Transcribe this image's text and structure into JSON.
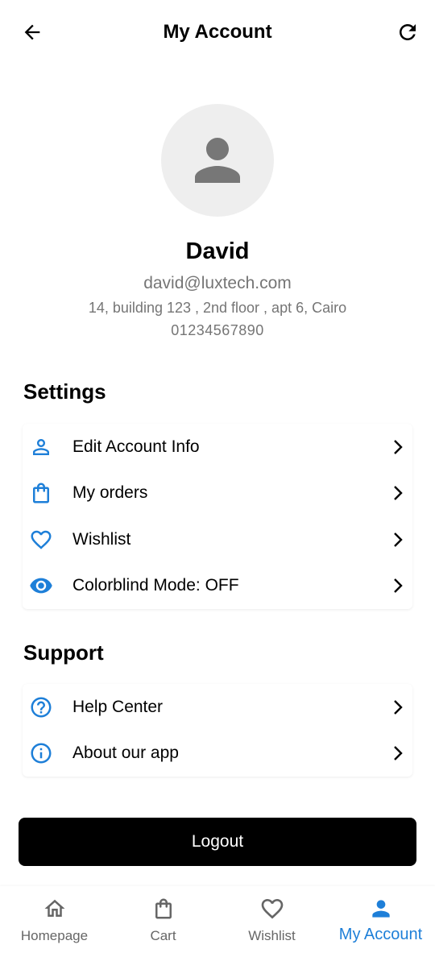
{
  "appbar": {
    "title": "My Account",
    "back_icon": "arrow-back-icon",
    "refresh_icon": "refresh-icon"
  },
  "profile": {
    "name": "David",
    "email": "david@luxtech.com",
    "address": "14, building 123 , 2nd floor , apt 6, Cairo",
    "phone": "01234567890",
    "avatar_icon": "person-icon"
  },
  "settings": {
    "title": "Settings",
    "items": [
      {
        "label": "Edit Account Info",
        "icon": "person-outline-icon"
      },
      {
        "label": "My orders",
        "icon": "shopping-bag-icon"
      },
      {
        "label": "Wishlist",
        "icon": "heart-outline-icon"
      },
      {
        "label": "Colorblind Mode: OFF",
        "icon": "eye-icon"
      }
    ]
  },
  "support": {
    "title": "Support",
    "items": [
      {
        "label": "Help Center",
        "icon": "help-circle-icon"
      },
      {
        "label": "About our app",
        "icon": "info-circle-icon"
      }
    ]
  },
  "logout_label": "Logout",
  "bottom_nav": {
    "items": [
      {
        "label": "Homepage",
        "icon": "home-icon",
        "active": false
      },
      {
        "label": "Cart",
        "icon": "shopping-bag-icon",
        "active": false
      },
      {
        "label": "Wishlist",
        "icon": "heart-outline-icon",
        "active": false
      },
      {
        "label": "My Account",
        "icon": "person-icon",
        "active": true
      }
    ]
  },
  "colors": {
    "accent": "#1e7fd8",
    "muted_text": "#757575",
    "avatar_bg": "#eeeeee",
    "avatar_icon": "#777777"
  }
}
